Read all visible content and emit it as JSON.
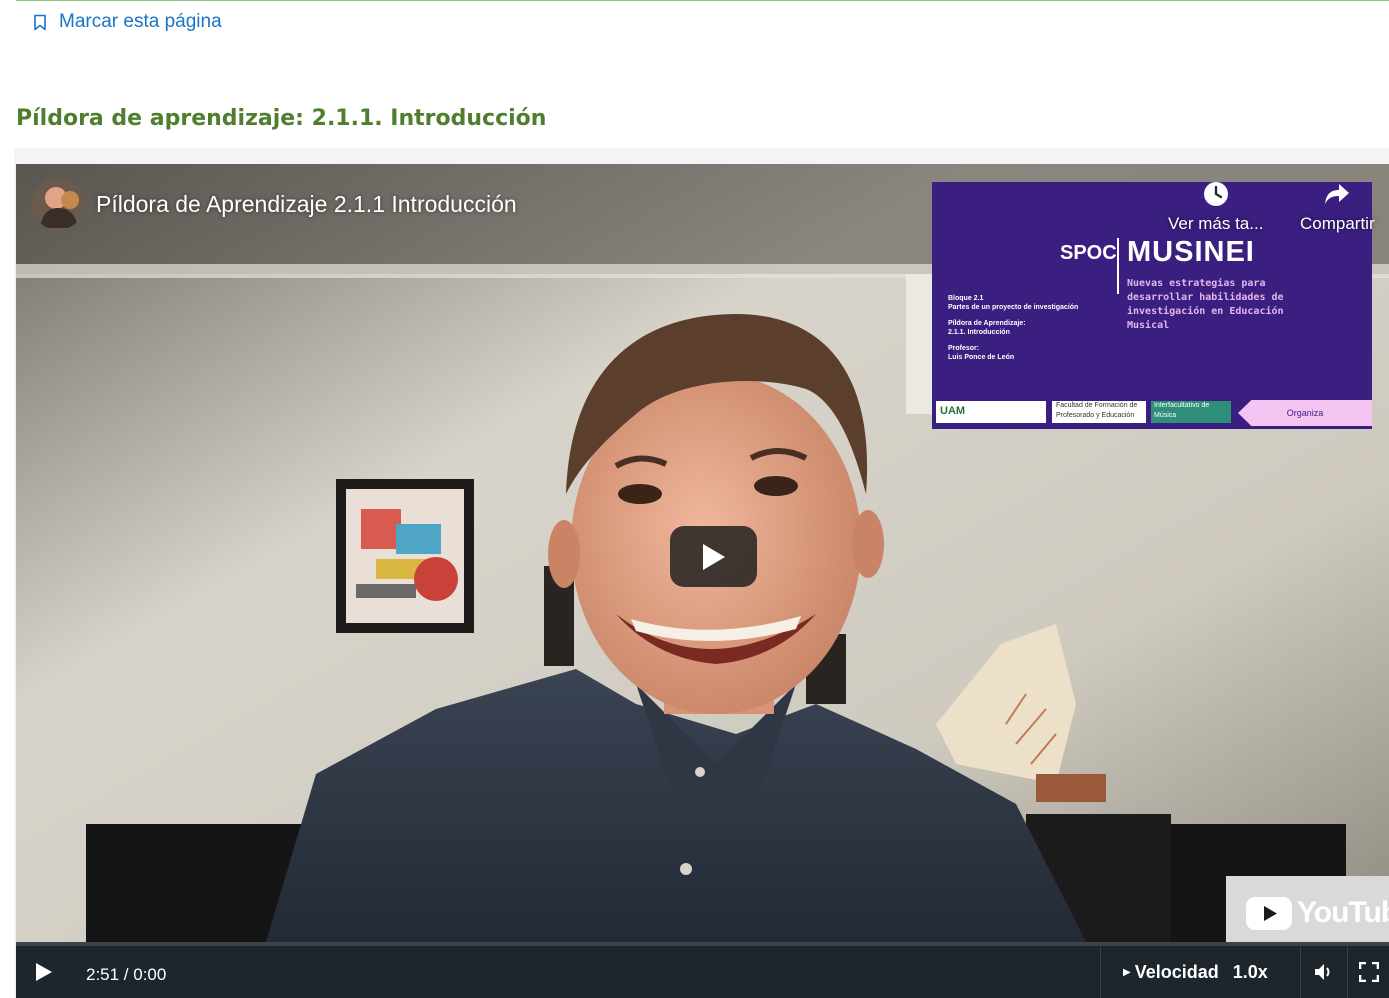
{
  "page": {
    "bookmark_label": "Marcar esta página",
    "unit_title": "Píldora de aprendizaje: 2.1.1. Introducción"
  },
  "video": {
    "title": "Píldora de Aprendizaje 2.1.1 Introducción",
    "watch_later_label": "Ver más ta...",
    "share_label": "Compartir",
    "youtube_wordmark": "YouTube",
    "slide": {
      "spoc": "SPOC",
      "brand": "MUSINEI",
      "subtitle": "Nuevas estrategias para desarrollar habilidades de investigación en Educación Musical",
      "block": "Bloque 2.1",
      "block_desc": "Partes de un proyecto de investigación",
      "pill_label": "Píldora de Aprendizaje:",
      "pill_value": "2.1.1. Introducción",
      "professor_label": "Profesor:",
      "professor_name": "Luis Ponce de León",
      "logo_uam": "UAM",
      "logo_faculty": "Facultad de Formación de Profesorado y Educación",
      "logo_inter": "Interfacultativo de Música",
      "organizer": "Organiza"
    }
  },
  "controls": {
    "time_display": "2:51 / 0:00",
    "speed_label": "Velocidad",
    "speed_value": "1.0x"
  },
  "colors": {
    "link_blue": "#1b74c4",
    "title_green": "#4f7f2e",
    "control_bar": "#1d262d",
    "slide_purple": "#3a1f80"
  },
  "icons": {
    "bookmark": "bookmark-outline-icon",
    "watch_later": "clock-icon",
    "share": "share-arrow-icon",
    "play": "play-icon",
    "volume": "volume-icon",
    "fullscreen": "fullscreen-icon"
  }
}
